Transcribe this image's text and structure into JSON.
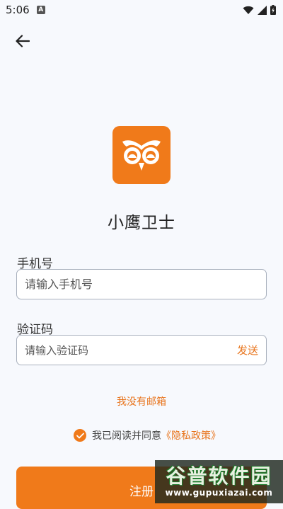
{
  "status_bar": {
    "time": "5:06",
    "notification_badge": "A",
    "icons": [
      "wifi-icon",
      "signal-icon",
      "battery-icon"
    ]
  },
  "app": {
    "name": "小鹰卫士",
    "brand_color": "#f07a1a",
    "logo_icon": "owl-icon"
  },
  "phone_field": {
    "label": "手机号",
    "value": "",
    "placeholder": "请输入手机号"
  },
  "code_field": {
    "label": "验证码",
    "value": "",
    "placeholder": "请输入验证码",
    "send_label": "发送"
  },
  "no_email_link": "我没有邮箱",
  "agreement": {
    "checked": true,
    "text": "我已阅读并同意",
    "policy_link": "《隐私政策》"
  },
  "register_button": {
    "label": "注册"
  },
  "watermark": {
    "title": "谷普软件园",
    "url": "www.gupuxiazai.com"
  }
}
